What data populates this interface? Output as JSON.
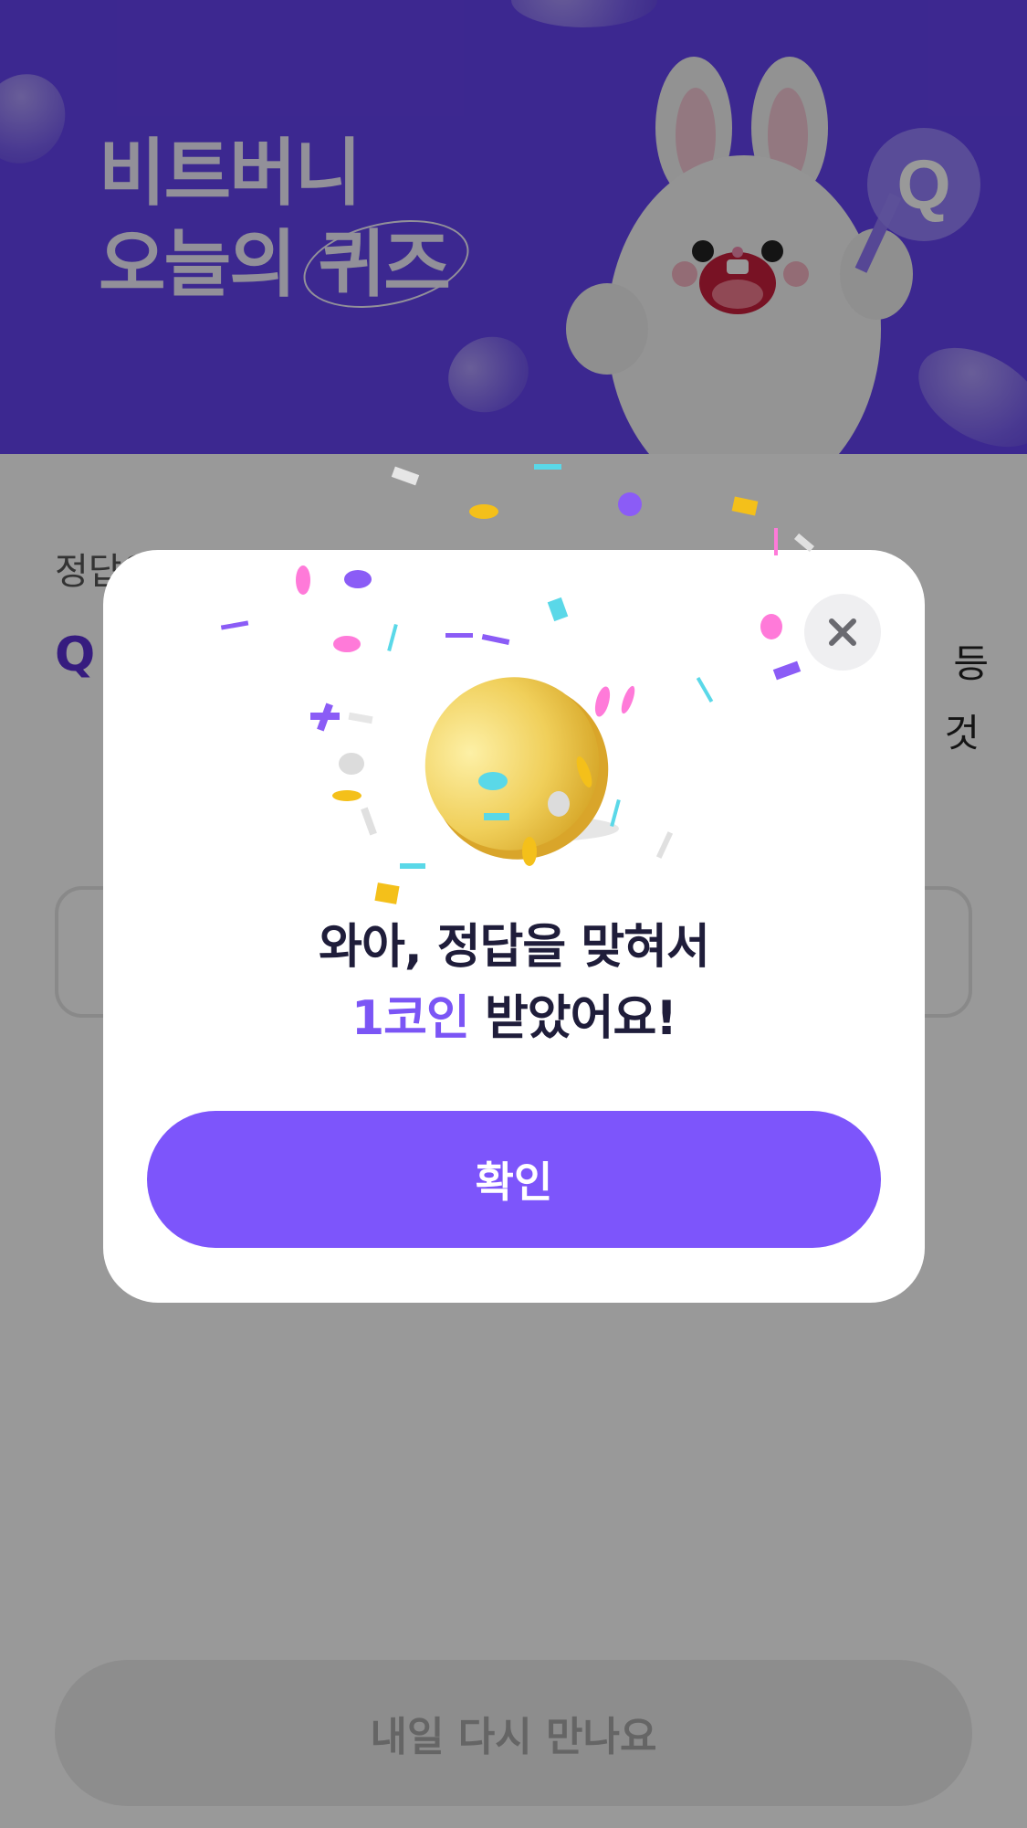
{
  "colors": {
    "banner_bg": "#6543f0",
    "accent": "#7b55f5",
    "confirm_button": "#7d55fb",
    "title_text": "#1f1d3a"
  },
  "banner": {
    "title_line1": "비트버니",
    "title_line2_prefix": "오늘의",
    "title_line2_highlight": "퀴즈",
    "mascot_icon": "bunny-mascot-holding-q-sign"
  },
  "page": {
    "hint_text": "정답은",
    "question_mark": "Q",
    "side_text_1": "등",
    "side_text_2": "것",
    "bottom_button_label": "내일 다시 만나요"
  },
  "modal": {
    "close_icon": "close-icon",
    "coin_icon": "gold-coin-icon",
    "message_line1": "와아, 정답을 맞혀서",
    "message_accent": "1코인",
    "message_line2_rest": " 받았어요!",
    "confirm_label": "확인"
  }
}
